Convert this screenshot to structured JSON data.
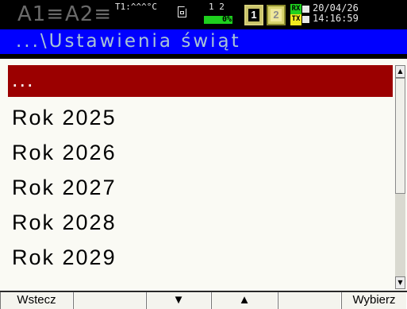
{
  "status": {
    "alarm_a1": "A1≡",
    "alarm_a2": "A2≡",
    "temperature": "T1:^^^°C",
    "sd_icon": "sd-card-icon",
    "channel_numbers": "1 2",
    "fill_percent_label": "0%",
    "channel1_label": "1",
    "channel2_label": "2",
    "rx_label": "RX",
    "tx_label": "TX",
    "date": "20/04/26",
    "time": "14:16:59",
    "colors": {
      "fill": "#1ed01e",
      "rxtx": "#f0e81e"
    }
  },
  "title": "...\\Ustawienia świąt",
  "list": {
    "items": [
      {
        "label": "...",
        "selected": true
      },
      {
        "label": "Rok 2025"
      },
      {
        "label": "Rok 2026"
      },
      {
        "label": "Rok 2027"
      },
      {
        "label": "Rok 2028"
      },
      {
        "label": "Rok 2029"
      }
    ],
    "selected_color": "#9b0000",
    "scroll_up_icon": "scroll-up-arrow-icon",
    "scroll_down_icon": "scroll-down-arrow-icon"
  },
  "softkeys": {
    "back": "Wstecz",
    "blank1": "",
    "down": "▼",
    "up": "▲",
    "blank2": "",
    "select": "Wybierz"
  },
  "colors": {
    "title_bar": "#0000ff",
    "title_text": "#a9c4d6"
  }
}
